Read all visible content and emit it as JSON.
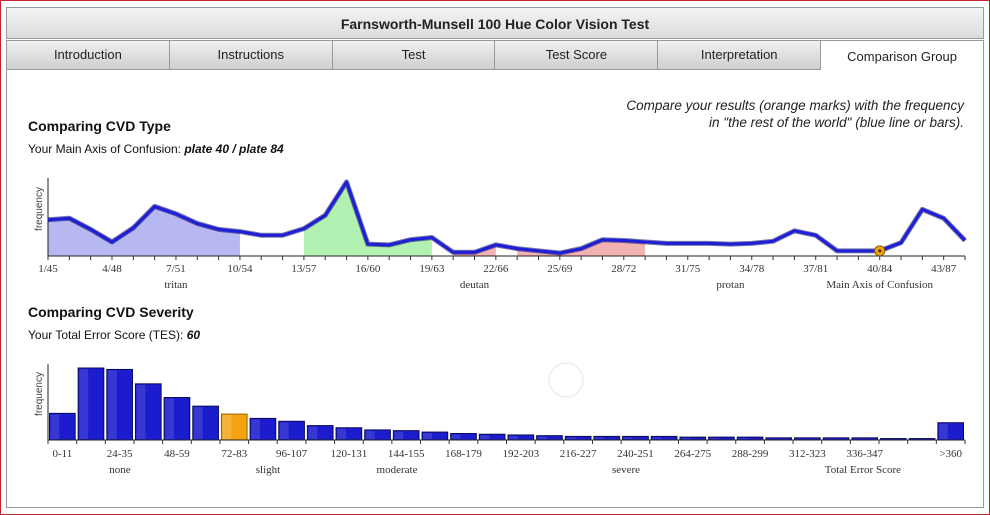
{
  "window": {
    "title": "Farnsworth-Munsell 100 Hue Color Vision Test"
  },
  "tabs": [
    {
      "label": "Introduction"
    },
    {
      "label": "Instructions"
    },
    {
      "label": "Test"
    },
    {
      "label": "Test Score"
    },
    {
      "label": "Interpretation"
    },
    {
      "label": "Comparison Group",
      "active": true
    }
  ],
  "note": {
    "line1": "Compare your results (orange marks) with the frequency",
    "line2": "in \"the rest of the world\" (blue line or bars)."
  },
  "type_section": {
    "heading": "Comparing CVD Type",
    "axis_label_prefix": "Your Main Axis of Confusion: ",
    "axis_value": "plate 40 / plate 84"
  },
  "severity_section": {
    "heading": "Comparing CVD Severity",
    "tes_prefix": "Your Total Error Score (TES): ",
    "tes_value": "60"
  },
  "colors": {
    "line": "#1e1ed8",
    "orange": "#f2a30f",
    "tritan_fill": "#b7b8f2",
    "deutan_fill": "#b2f1b2",
    "protan_fill": "#f2b2b2"
  },
  "chart_data": [
    {
      "type": "area",
      "title": "Comparing CVD Type",
      "ylabel": "frequency",
      "xlabel": "Main Axis of Confusion",
      "tick_labels": [
        "1/45",
        "4/48",
        "7/51",
        "10/54",
        "13/57",
        "16/60",
        "19/63",
        "22/66",
        "25/69",
        "28/72",
        "31/75",
        "34/78",
        "37/81",
        "40/84",
        "43/87"
      ],
      "region_labels": [
        "tritan",
        "deutan",
        "protan"
      ],
      "regions": [
        {
          "name": "tritan",
          "from": 0,
          "to": 9
        },
        {
          "name": "deutan",
          "from": 12,
          "to": 18
        },
        {
          "name": "protan",
          "from": 19,
          "to": 21
        },
        {
          "name": "protan",
          "from": 22,
          "to": 28
        }
      ],
      "values": [
        0.49,
        0.51,
        0.36,
        0.19,
        0.38,
        0.67,
        0.57,
        0.44,
        0.36,
        0.33,
        0.28,
        0.28,
        0.37,
        0.55,
        1.0,
        0.16,
        0.15,
        0.22,
        0.25,
        0.05,
        0.05,
        0.15,
        0.1,
        0.07,
        0.04,
        0.1,
        0.22,
        0.21,
        0.19,
        0.17,
        0.17,
        0.17,
        0.16,
        0.17,
        0.2,
        0.34,
        0.28,
        0.07,
        0.07,
        0.07,
        0.18,
        0.63,
        0.51,
        0.21
      ],
      "marker": {
        "index": 39,
        "label": "40/84"
      }
    },
    {
      "type": "bar",
      "title": "Comparing CVD Severity",
      "ylabel": "frequency",
      "xlabel": "Total Error Score",
      "tick_labels": [
        "0-11",
        "24-35",
        "48-59",
        "72-83",
        "96-107",
        "120-131",
        "144-155",
        "168-179",
        "192-203",
        "216-227",
        "240-251",
        "264-275",
        "288-299",
        "312-323",
        "336-347",
        ">360"
      ],
      "region_labels": [
        "none",
        "slight",
        "moderate",
        "severe"
      ],
      "values": [
        0.37,
        1.0,
        0.98,
        0.78,
        0.59,
        0.47,
        0.36,
        0.3,
        0.26,
        0.2,
        0.17,
        0.14,
        0.13,
        0.11,
        0.09,
        0.08,
        0.07,
        0.06,
        0.05,
        0.05,
        0.05,
        0.05,
        0.04,
        0.04,
        0.04,
        0.03,
        0.03,
        0.03,
        0.03,
        0.02,
        0.02,
        0.24
      ],
      "highlight_index": 6
    }
  ]
}
